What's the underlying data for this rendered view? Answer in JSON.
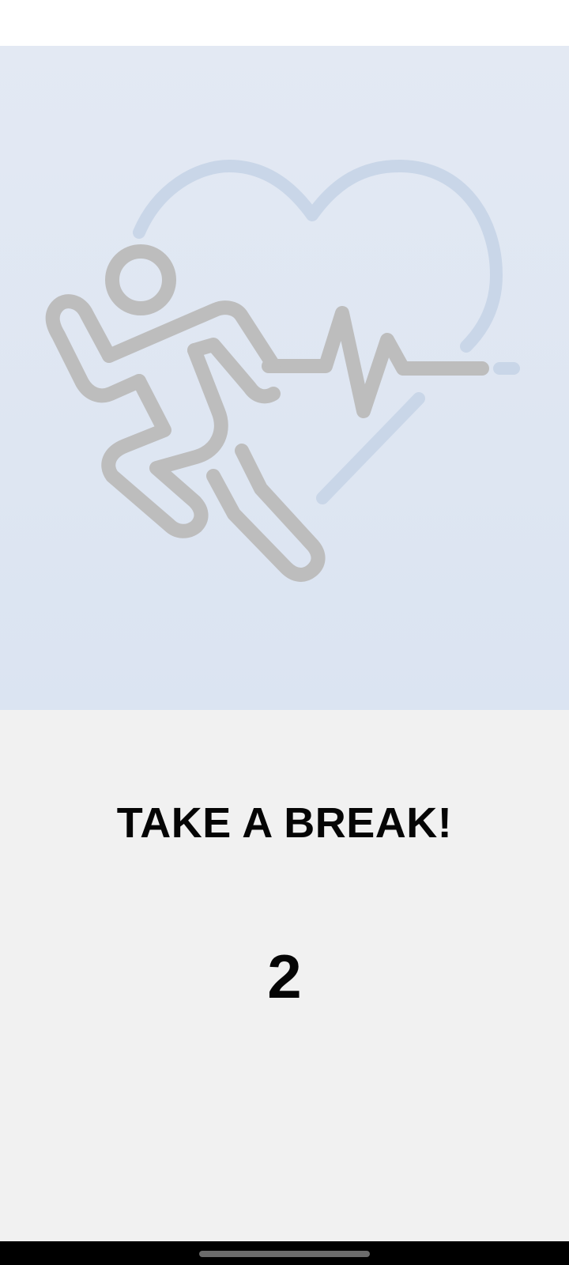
{
  "screen": {
    "title": "TAKE A BREAK!",
    "countdown": "2"
  },
  "hero": {
    "illustration": "running-person-heartbeat-icon",
    "person_color": "#bdbdbd",
    "heart_color": "#c9d6e8",
    "background_top": "#e3e9f3",
    "background_bottom": "#dbe4f2"
  },
  "colors": {
    "page_background": "#f1f1f1",
    "text": "#050505",
    "status_bar": "#ffffff",
    "nav_bar": "#000000"
  }
}
